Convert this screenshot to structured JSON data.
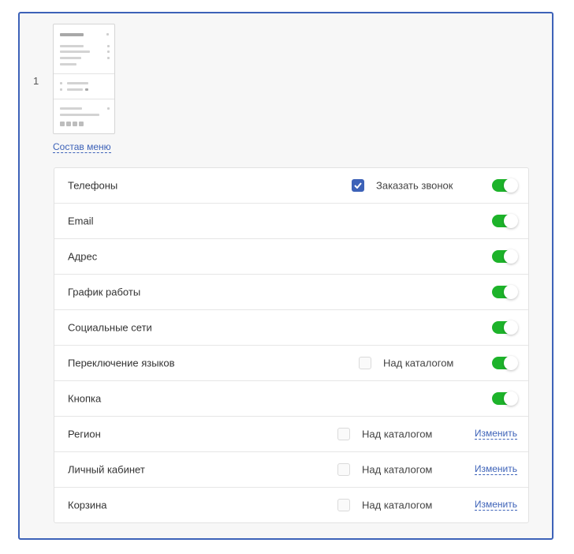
{
  "variant": {
    "number": "1"
  },
  "menu_link": "Состав меню",
  "accent_color": "#3d62b8",
  "toggle_color": "#1db32a",
  "rows": [
    {
      "label": "Телефоны",
      "option_label": "Заказать звонок",
      "option_checked": true,
      "toggle_on": true
    },
    {
      "label": "Email",
      "toggle_on": true
    },
    {
      "label": "Адрес",
      "toggle_on": true
    },
    {
      "label": "График работы",
      "toggle_on": true
    },
    {
      "label": "Социальные сети",
      "toggle_on": true
    },
    {
      "label": "Переключение языков",
      "option_label": "Над каталогом",
      "option_checked": false,
      "toggle_on": true
    },
    {
      "label": "Кнопка",
      "toggle_on": true
    },
    {
      "label": "Регион",
      "option_label": "Над каталогом",
      "option_checked": false,
      "link": "Изменить"
    },
    {
      "label": "Личный кабинет",
      "option_label": "Над каталогом",
      "option_checked": false,
      "link": "Изменить"
    },
    {
      "label": "Корзина",
      "option_label": "Над каталогом",
      "option_checked": false,
      "link": "Изменить"
    }
  ]
}
